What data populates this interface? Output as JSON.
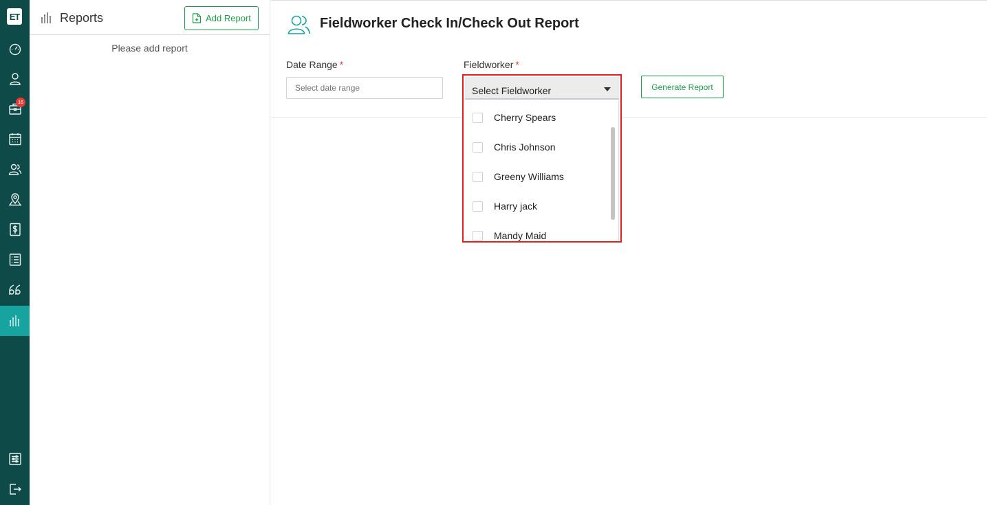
{
  "app": {
    "logo_text": "ET"
  },
  "rail": {
    "items": [
      {
        "icon": "dashboard-icon"
      },
      {
        "icon": "user-icon"
      },
      {
        "icon": "briefcase-icon",
        "badge": "16"
      },
      {
        "icon": "calendar-icon"
      },
      {
        "icon": "users-icon"
      },
      {
        "icon": "map-pin-icon"
      },
      {
        "icon": "dollar-icon"
      },
      {
        "icon": "list-icon"
      },
      {
        "icon": "quote-icon"
      },
      {
        "icon": "reports-icon",
        "active": true
      }
    ],
    "bottom": [
      {
        "icon": "settings-sliders-icon"
      },
      {
        "icon": "logout-icon"
      }
    ]
  },
  "reports_panel": {
    "title": "Reports",
    "add_button": "Add Report",
    "empty_message": "Please add report"
  },
  "main": {
    "title": "Fieldworker Check In/Check Out Report",
    "date_range": {
      "label": "Date Range",
      "required_mark": "*",
      "placeholder": "Select date range"
    },
    "fieldworker": {
      "label": "Fieldworker",
      "required_mark": "*",
      "selected": "Select Fieldworker",
      "options": [
        "Cherry Spears",
        "Chris Johnson",
        "Greeny Williams",
        "Harry jack",
        "Mandy Maid"
      ]
    },
    "generate_button": "Generate Report"
  },
  "colors": {
    "rail_bg": "#0d4a48",
    "rail_active": "#17a3a0",
    "accent_green": "#1e9b4a",
    "highlight_red": "#e41f1f",
    "badge_red": "#e53935"
  }
}
